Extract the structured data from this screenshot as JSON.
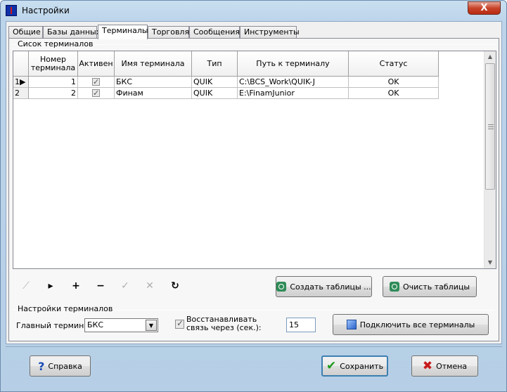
{
  "window": {
    "title": "Настройки",
    "close_label": "X"
  },
  "tabs": [
    {
      "label": "Общие"
    },
    {
      "label": "Базы данных"
    },
    {
      "label": "Терминалы"
    },
    {
      "label": "Торговля"
    },
    {
      "label": "Сообщения"
    },
    {
      "label": "Инструменты"
    }
  ],
  "terminals_group": {
    "title": "Сисок терминалов",
    "columns": [
      "Номер терминала",
      "Активен",
      "Имя терминала",
      "Тип",
      "Путь к терминалу",
      "Статус"
    ],
    "rows": [
      {
        "indicator": "1▶",
        "number": "1",
        "active": true,
        "name": "БКС",
        "type": "QUIK",
        "path": "C:\\BCS_Work\\QUIK-J",
        "status": "OK"
      },
      {
        "indicator": "2",
        "number": "2",
        "active": true,
        "name": "Финам",
        "type": "QUIK",
        "path": "E:\\FinamJunior",
        "status": "OK"
      }
    ]
  },
  "navigator": {
    "buttons": [
      {
        "glyph": "⟋",
        "enabled": false
      },
      {
        "glyph": "▸",
        "enabled": true
      },
      {
        "glyph": "+",
        "enabled": true
      },
      {
        "glyph": "−",
        "enabled": true
      },
      {
        "glyph": "✓",
        "enabled": false
      },
      {
        "glyph": "✕",
        "enabled": false
      },
      {
        "glyph": "↻",
        "enabled": true
      }
    ]
  },
  "actions": {
    "create_tables": "Создать таблицы ...",
    "clear_tables": "Очисть таблицы"
  },
  "settings_group": {
    "title": "Настройки терминалов",
    "main_terminal_label": "Главный терминал:",
    "main_terminal_value": "БКС",
    "reconnect_label": "Восстанавливать связь через (сек.):",
    "reconnect_checked": true,
    "reconnect_value": "15",
    "connect_all": "Подключить все терминалы"
  },
  "footer": {
    "help": "Справка",
    "save": "Сохранить",
    "cancel": "Отмена"
  }
}
